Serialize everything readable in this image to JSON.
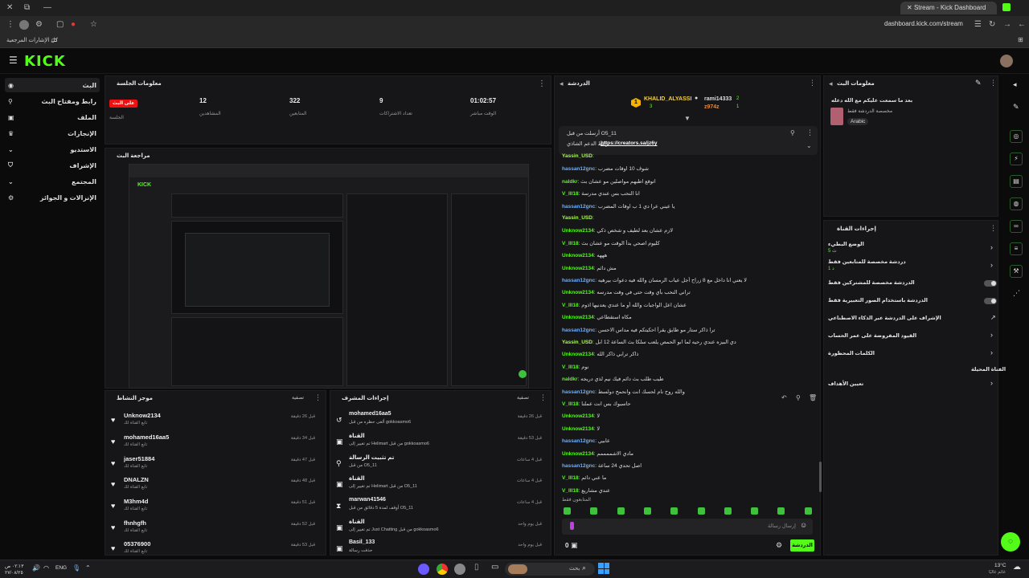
{
  "browser": {
    "tab_title": "Stream - Kick Dashboard",
    "url": "dashboard.kick.com/stream",
    "bookmarks_label": "كل الإشارات المرجعية"
  },
  "brand": {
    "logo": "KICK",
    "accent": "#53fc18"
  },
  "sidebar": {
    "items": [
      {
        "label": "البث",
        "icon": "live-icon"
      },
      {
        "label": "رابط ومفتاح البث",
        "icon": "key-icon"
      },
      {
        "label": "الملف",
        "icon": "profile-icon"
      },
      {
        "label": "الإنجازات",
        "icon": "trophy-icon"
      },
      {
        "label": "الاستديو",
        "icon": "studio-icon"
      },
      {
        "label": "الإشراف",
        "icon": "shield-icon"
      },
      {
        "label": "المجتمع",
        "icon": "community-icon"
      },
      {
        "label": "الإنزالات و الجوائز",
        "icon": "gift-icon"
      }
    ]
  },
  "session": {
    "title": "معلومات الجلسة",
    "live_badge": "على البث",
    "stats": [
      {
        "value": "",
        "label": "الجلسة"
      },
      {
        "value": "12",
        "label": "المشاهدين"
      },
      {
        "value": "322",
        "label": "المتابعين"
      },
      {
        "value": "9",
        "label": "تعداد الاشتراكات"
      },
      {
        "value": "01:02:57",
        "label": "الوقت مباشر"
      }
    ]
  },
  "preview": {
    "title": "مراجعة البث"
  },
  "activity": {
    "title": "موجز النشاط",
    "filter": "تصفية",
    "rows": [
      {
        "name": "Unknow2134",
        "sub": "تابع القناة لك",
        "time": "قبل 26 دقيقة"
      },
      {
        "name": "mohamed16aa5",
        "sub": "تابع القناة لك",
        "time": "قبل 34 دقيقة"
      },
      {
        "name": "jaser51884",
        "sub": "تابع القناة لك",
        "time": "قبل 47 دقيقة"
      },
      {
        "name": "DNALZN",
        "sub": "تابع القناة لك",
        "time": "قبل 48 دقيقة"
      },
      {
        "name": "M3hm4d",
        "sub": "تابع القناة لك",
        "time": "قبل 51 دقيقة"
      },
      {
        "name": "fhnhgfh",
        "sub": "تابع القناة لك",
        "time": "قبل 52 دقيقة"
      },
      {
        "name": "05376900",
        "sub": "تابع القناة لك",
        "time": "قبل 53 دقيقة"
      }
    ]
  },
  "moderation": {
    "title": "إجراءات المشرف",
    "filter": "تصفية",
    "rows": [
      {
        "icon": "timeout-icon",
        "name": "mohamed16aa5",
        "sub": "ألغى حظره من قبل gokkoasmo6",
        "time": "قبل 26 دقيقة"
      },
      {
        "icon": "channel-icon",
        "name": "القناة",
        "sub": "تم تغيير إلى Helimart من قبل gokkoasmo6",
        "time": "قبل 53 دقيقة"
      },
      {
        "icon": "pin-icon",
        "name": "تم تثبيت الرسالة",
        "sub": "من قبل O5_11",
        "time": "قبل 4 ساعات"
      },
      {
        "icon": "channel-icon",
        "name": "القناة",
        "sub": "تم تغيير إلى Helimart من قبل O5_11",
        "time": "قبل 4 ساعات"
      },
      {
        "icon": "hourglass-icon",
        "name": "marwan41546",
        "sub": "أوقف لمدة 5 دقائق من قبل O5_11",
        "time": "قبل 4 ساعات"
      },
      {
        "icon": "channel-icon",
        "name": "القناة",
        "sub": "تم تغيير إلى Just Chatting من قبل gokkoasmo6",
        "time": "قبل يوم واحد"
      },
      {
        "icon": "channel-icon",
        "name": "Basil_133",
        "sub": "حذفت رسالة",
        "time": "قبل يوم واحد"
      }
    ]
  },
  "chat": {
    "title": "الدردشة",
    "leaderboard": [
      {
        "rank": "1",
        "name": "KHALID_ALYASSI",
        "count": "3"
      },
      {
        "rank": "",
        "name": "rami14333",
        "count": "2"
      },
      {
        "rank": "",
        "name": "z974z",
        "count": "1"
      }
    ],
    "pinned": {
      "by": "أرسلت من قبل O5_11",
      "text": "رابط الدعم الشاذي",
      "link": "https://creators.sa/jz6y"
    },
    "messages": [
      {
        "user": "Yassin_USD",
        "text": "",
        "color": "lime"
      },
      {
        "user": "hassan12gnc",
        "text": "شوف 10 اوقات مضرب",
        "color": "blue"
      },
      {
        "user": "naldkr",
        "text": "اتوقع اطبهم مواصلين مو عشان بث",
        "color": "green"
      },
      {
        "user": "V_lll18",
        "text": "انا النحب بس عندي مدرسة",
        "color": "green"
      },
      {
        "user": "hassan12gnc",
        "text": "يا عيني عرا دي 1 ب اوقات المضرب",
        "color": "blue"
      },
      {
        "user": "Yassin_USD",
        "text": "",
        "color": "lime"
      },
      {
        "user": "Unknow2134",
        "text": "لازم عشان بعد لطيف و شخص ذكي",
        "color": "green"
      },
      {
        "user": "V_lll18",
        "text": "كليوم اصحي بدأ الوقت مو عشان بث",
        "color": "green"
      },
      {
        "user": "Unknow2134",
        "text": "هههه",
        "color": "green"
      },
      {
        "user": "Unknow2134",
        "text": "مش دائم",
        "color": "green"
      },
      {
        "user": "hassan12gnc",
        "text": "لا يعني انا داخل مع 8 زراح أجل عياب الرمسان والله فيه دعوات بيرهيه",
        "color": "blue"
      },
      {
        "user": "Unknow2134",
        "text": "تراني النحب بأي وقت حتى في وقت مدرسه",
        "color": "green"
      },
      {
        "user": "V_lll18",
        "text": "عشان اعل الواجبات والله أو ما عندي يعدنيها اذوم",
        "color": "green"
      },
      {
        "user": "Unknow2134",
        "text": "مكاه استقطاعي",
        "color": "green"
      },
      {
        "user": "hassan12gnc",
        "text": "ترا ذاكر ستار مو طايق يقرأ احكيتكم فيه مداس الاحسن",
        "color": "blue"
      },
      {
        "user": "Yassin_USD",
        "text": "دي البيزه عندي رحيه لما ابو الحمص يلعب سلكا بث الساعة 12 ابل",
        "color": "lime"
      },
      {
        "user": "Unknow2134",
        "text": "ذاكر ترابي ذاكر الله",
        "color": "green"
      },
      {
        "user": "V_lll18",
        "text": "نوم",
        "color": "green"
      },
      {
        "user": "naldkr",
        "text": "طيب طلب بث دائم فيك نيم لذي دريجه",
        "color": "green"
      },
      {
        "user": "hassan12gnc",
        "text": "والله روح نام لحسك انت وانحمح دولسط",
        "color": "blue"
      },
      {
        "user": "V_lll18",
        "text": "حاسبوك بس انت عملنا",
        "color": "green"
      },
      {
        "user": "Unknow2134",
        "text": "لا",
        "color": "green"
      },
      {
        "user": "Unknow2134",
        "text": "لا",
        "color": "green"
      },
      {
        "user": "hassan12gnc",
        "text": "عابيي",
        "color": "blue"
      },
      {
        "user": "Unknow2134",
        "text": "مادي الاشممممم",
        "color": "green"
      },
      {
        "user": "hassan12gnc",
        "text": "اصل تحدي 24 ساعة",
        "color": "blue"
      },
      {
        "user": "V_lll18",
        "text": "ما عني دائم",
        "color": "green"
      },
      {
        "user": "V_lll18",
        "text": "عندي مشاريع",
        "color": "green"
      }
    ],
    "followers_only": "المتابعون فقط",
    "input_placeholder": "إرسال رسالة",
    "send_label": "الدردشة",
    "count": "0"
  },
  "stream_info": {
    "title": "معلومات البث",
    "stream_title": "بعد ما سمعت عليكم مع الله دعله",
    "category": "مخصصة الدردشة فقط",
    "tag": "Arabic"
  },
  "channel_actions": {
    "title": "إجراءات القناة",
    "items": [
      {
        "label": "الوضع البطيء",
        "sub": "5 ث",
        "kind": "arrow"
      },
      {
        "label": "دردشة مخصصة للمتابعين فقط",
        "sub": "1 د",
        "kind": "arrow"
      },
      {
        "label": "الدردشة مخصصة للمشتركين فقط",
        "sub": "",
        "kind": "toggle"
      },
      {
        "label": "الدردشة باستخدام الصور التعبيرية فقط",
        "sub": "",
        "kind": "toggle"
      },
      {
        "label": "الإشراف على الدردشة عبر الذكاء الاصطناعي",
        "sub": "",
        "kind": "link"
      },
      {
        "label": "القيود المفروضة على عمر الحساب",
        "sub": "",
        "kind": "arrow"
      },
      {
        "label": "الكلمات المحظورة",
        "sub": "",
        "kind": "arrow"
      }
    ],
    "section": "الفناة المحيلة",
    "goals": "تعيين الأهداف"
  },
  "taskbar": {
    "lang": "ENG",
    "time": "٠٢:١٣ ص",
    "date": "٢٧/٠٨/٢٥",
    "weather": "13°C",
    "weather_sub": "غائم غالبًا",
    "search": "بحث"
  }
}
